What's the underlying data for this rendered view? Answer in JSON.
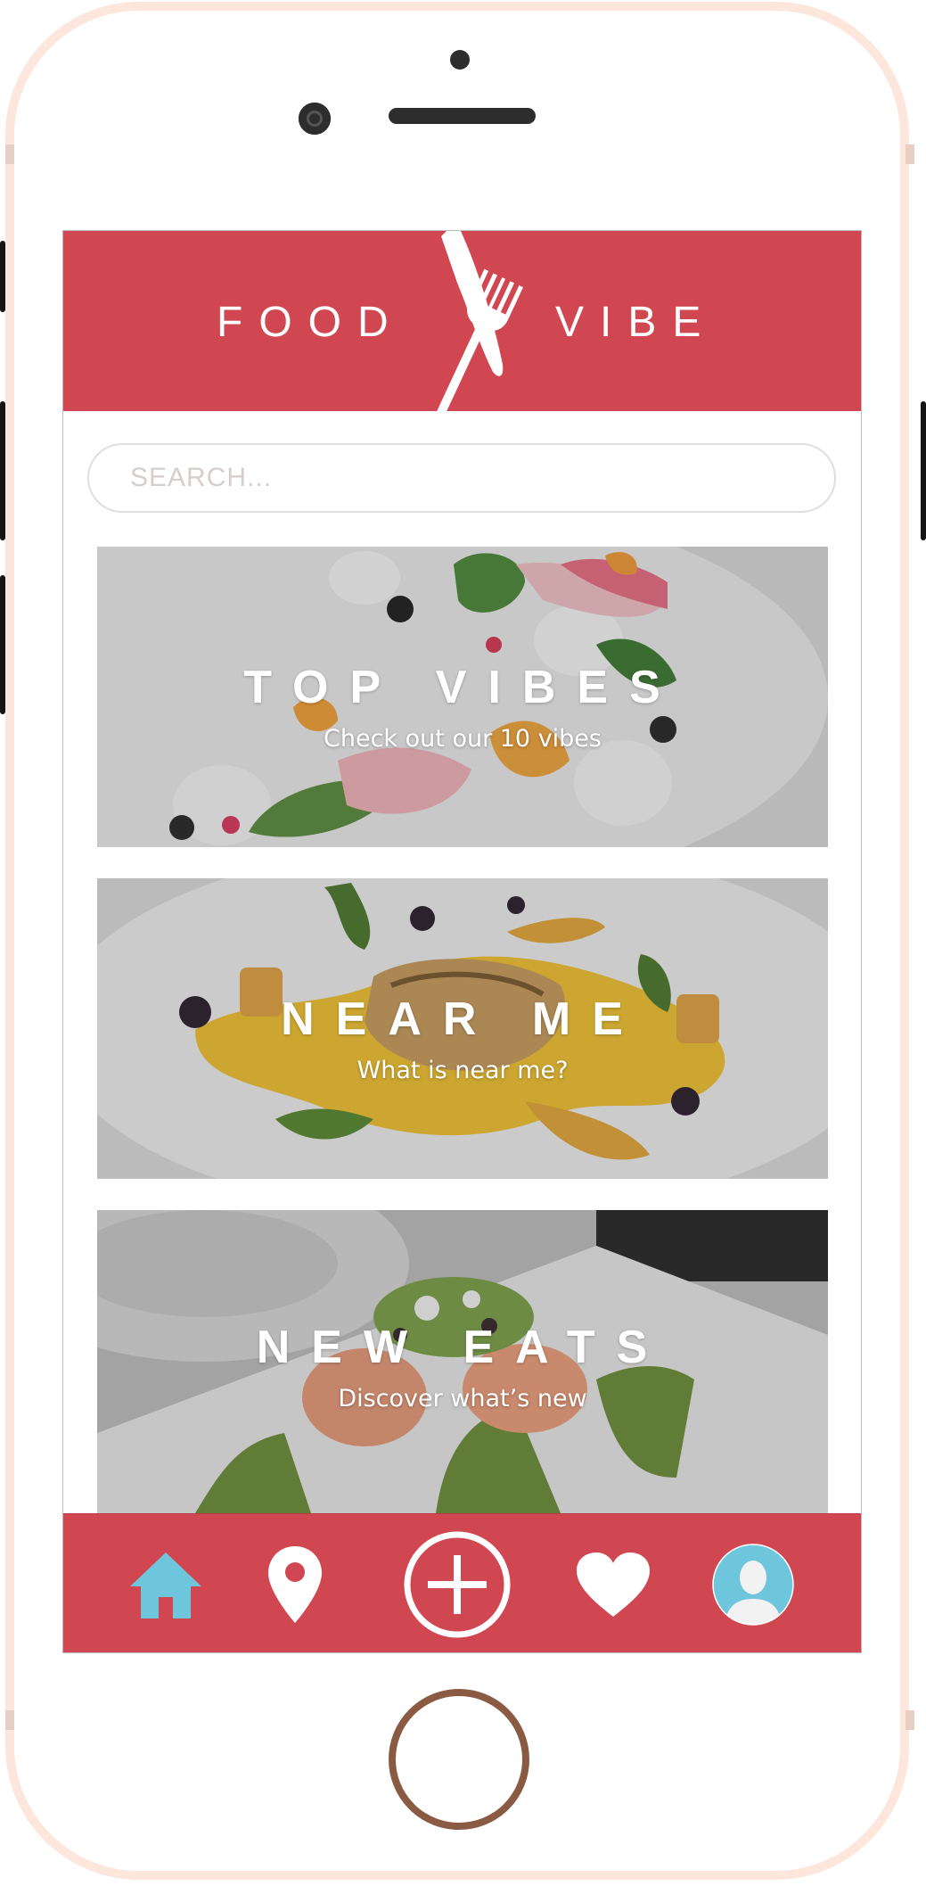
{
  "app": {
    "logo_left": "FOOD",
    "logo_right": "VIBE",
    "brand_color": "#d14751",
    "accent_color": "#6ec6dc"
  },
  "search": {
    "placeholder": "SEARCH..."
  },
  "cards": [
    {
      "title": "TOP VIBES",
      "subtitle": "Check out our 10 vibes"
    },
    {
      "title": "NEAR ME",
      "subtitle": "What is near me?"
    },
    {
      "title": "NEW EATS",
      "subtitle": "Discover what’s new"
    }
  ],
  "tabbar": {
    "items": [
      {
        "icon": "home-icon",
        "active": true
      },
      {
        "icon": "location-pin-icon"
      },
      {
        "icon": "add-circle-icon"
      },
      {
        "icon": "heart-icon"
      },
      {
        "icon": "profile-avatar-icon"
      }
    ]
  }
}
